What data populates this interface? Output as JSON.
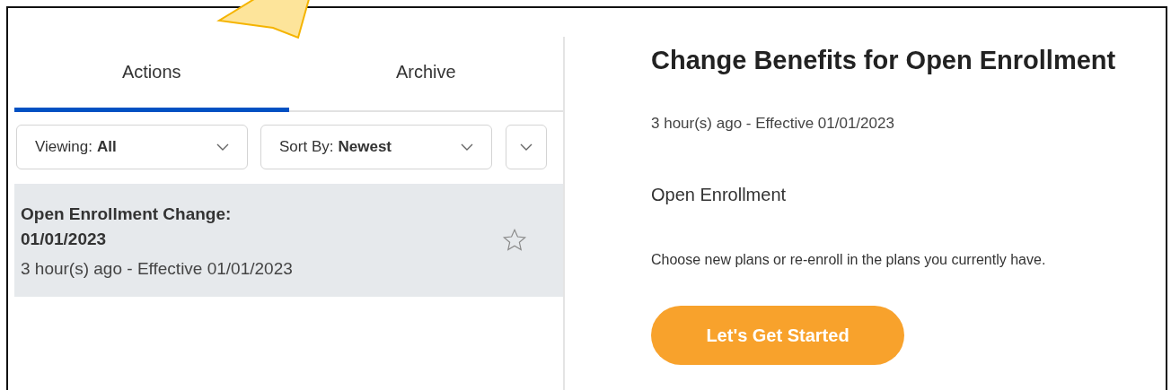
{
  "tabs": [
    {
      "label": "Actions",
      "selected": true
    },
    {
      "label": "Archive",
      "selected": false
    }
  ],
  "filters": [
    {
      "label": "Viewing:",
      "value": "All"
    },
    {
      "label": "Sort By:",
      "value": "Newest"
    }
  ],
  "items": [
    {
      "title": "Open Enrollment Change: 01/01/2023",
      "meta": "3 hour(s) ago - Effective 01/01/2023",
      "selected": true,
      "starred": false
    }
  ],
  "detail": {
    "title": "Change Benefits for Open Enrollment",
    "meta": "3 hour(s) ago -  Effective 01/01/2023",
    "subtitle": "Open Enrollment",
    "description": "Choose new plans or re-enroll in the plans you currently have.",
    "button": "Let's Get Started"
  }
}
